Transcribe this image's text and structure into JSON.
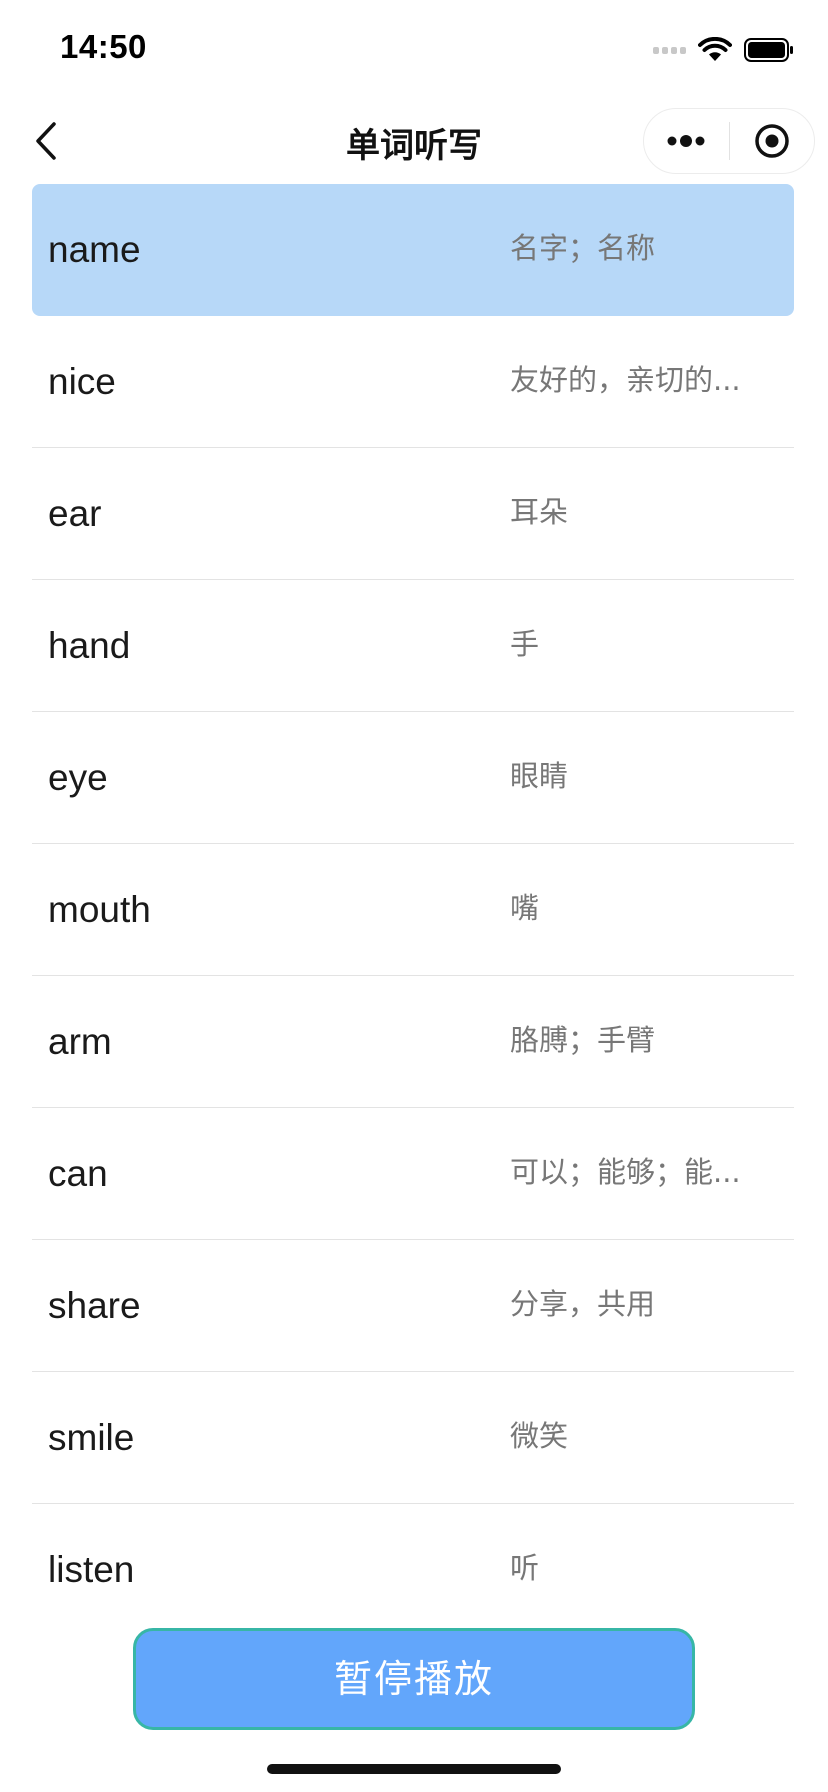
{
  "status_bar": {
    "time": "14:50"
  },
  "nav": {
    "title": "单词听写"
  },
  "words": [
    {
      "word": "name",
      "meaning": "名字；名称",
      "active": true
    },
    {
      "word": "nice",
      "meaning": "友好的，亲切的...",
      "active": false
    },
    {
      "word": "ear",
      "meaning": "耳朵",
      "active": false
    },
    {
      "word": "hand",
      "meaning": "手",
      "active": false
    },
    {
      "word": "eye",
      "meaning": "眼睛",
      "active": false
    },
    {
      "word": "mouth",
      "meaning": "嘴",
      "active": false
    },
    {
      "word": "arm",
      "meaning": "胳膊；手臂",
      "active": false
    },
    {
      "word": "can",
      "meaning": "可以；能够；能...",
      "active": false
    },
    {
      "word": "share",
      "meaning": "分享，共用",
      "active": false
    },
    {
      "word": "smile",
      "meaning": "微笑",
      "active": false
    },
    {
      "word": "listen",
      "meaning": "听",
      "active": false
    }
  ],
  "actions": {
    "pause_label": "暂停播放"
  },
  "colors": {
    "active_row": "#b7d8f8",
    "button_fill": "#62a6fb",
    "button_border": "#37b6a6",
    "meaning_text": "#777777"
  },
  "icons": {
    "back": "chevron-left-icon",
    "more": "more-dots-icon",
    "close": "target-circle-icon",
    "wifi": "wifi-icon",
    "battery": "battery-icon"
  }
}
